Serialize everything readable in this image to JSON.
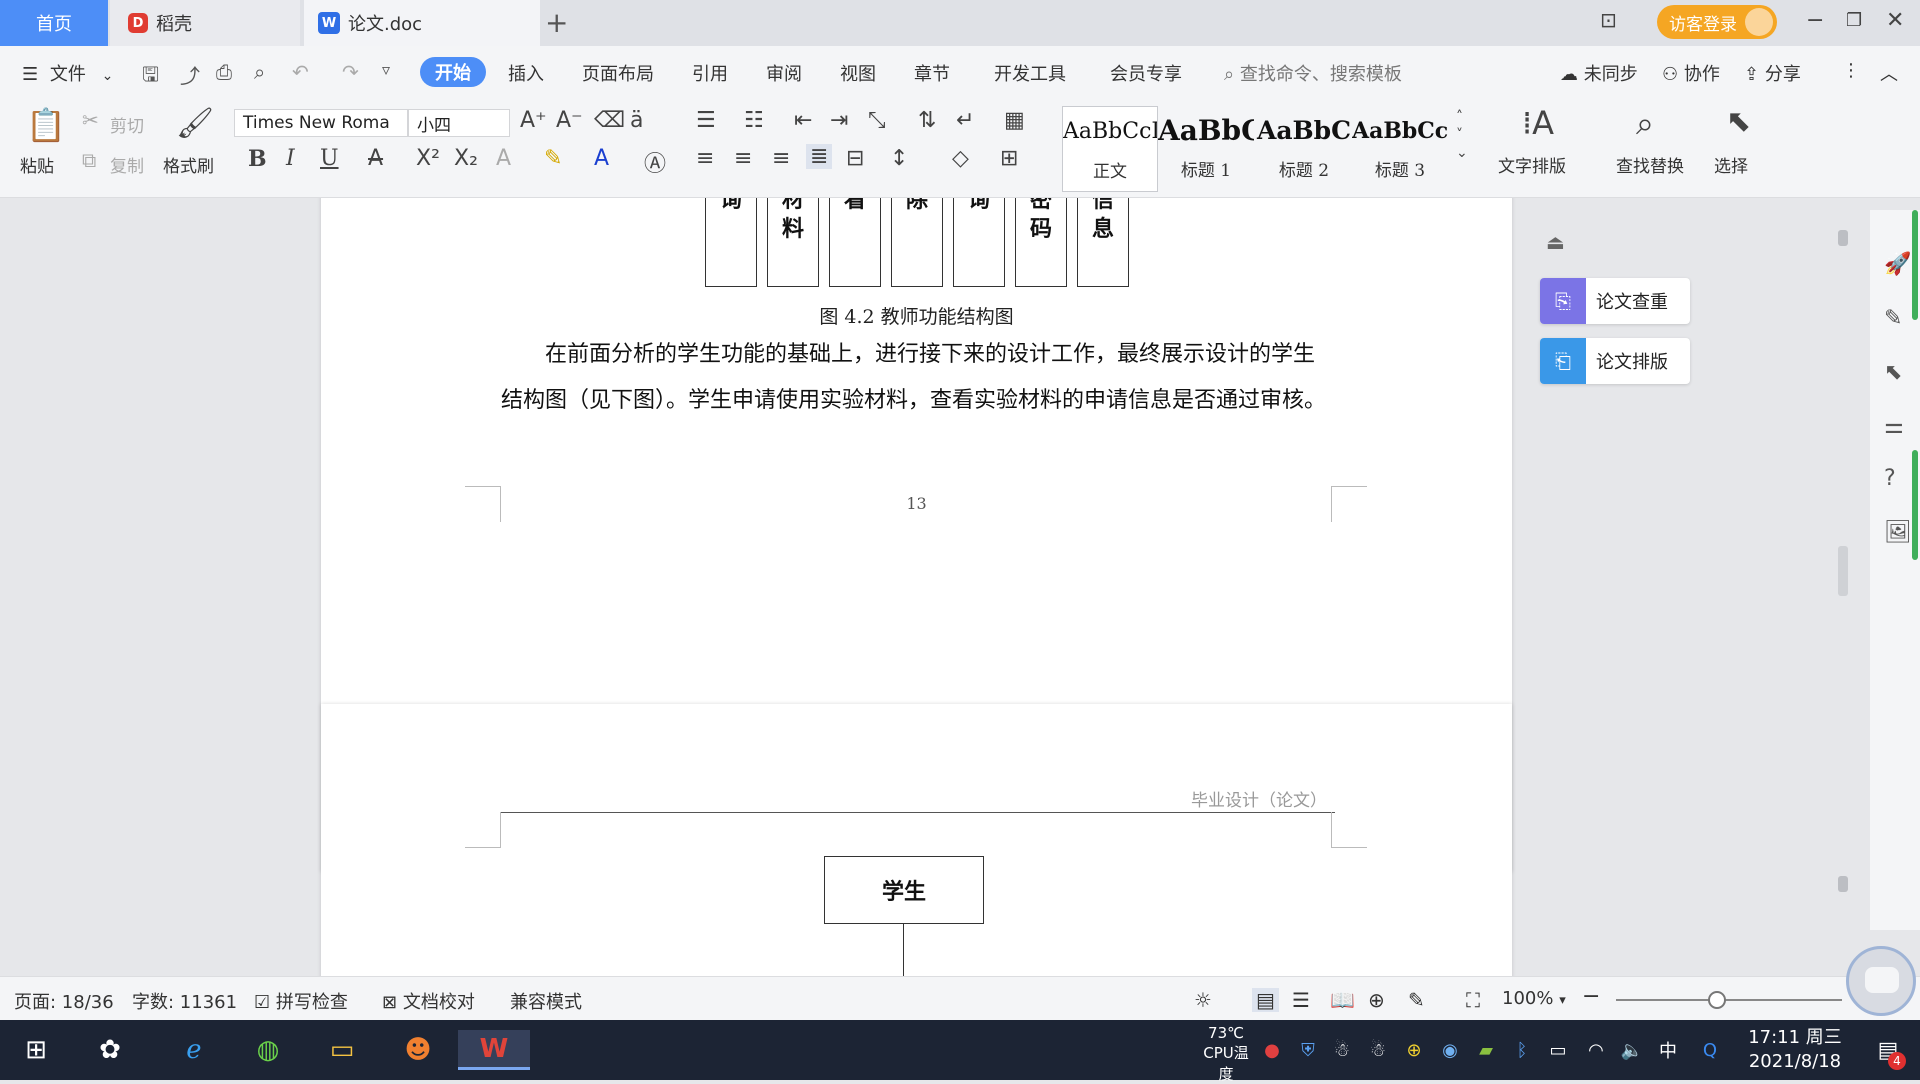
{
  "tabs": {
    "home": "首页",
    "daoke": "稻壳",
    "doc": "论文.doc",
    "plus": "+",
    "login": "访客登录"
  },
  "menu": {
    "file": "文件",
    "items": [
      "开始",
      "插入",
      "页面布局",
      "引用",
      "审阅",
      "视图",
      "章节",
      "开发工具",
      "会员专享"
    ],
    "search_placeholder": "查找命令、搜索模板",
    "unsynced": "未同步",
    "collab": "协作",
    "share": "分享"
  },
  "ribbon": {
    "paste": "粘贴",
    "cut": "剪切",
    "copy": "复制",
    "format_painter": "格式刷",
    "font_name": "Times New Roma",
    "font_size": "小四",
    "styles": [
      {
        "preview": "AaBbCcI",
        "name": "正文"
      },
      {
        "preview": "AaBbC",
        "name": "标题 1"
      },
      {
        "preview": "AaBbC",
        "name": "标题 2"
      },
      {
        "preview": "AaBbCcl",
        "name": "标题 3"
      }
    ],
    "text_layout": "文字排版",
    "find_replace": "查找替换",
    "select": "选择"
  },
  "document": {
    "function_boxes": [
      "询",
      "材料",
      "看",
      "除",
      "询",
      "密码",
      "信息"
    ],
    "figure_caption": "图 4.2  教师功能结构图",
    "paragraph": "在前面分析的学生功能的基础上，进行接下来的设计工作，最终展示设计的学生结构图（见下图）。学生申请使用实验材料，查看实验材料的申请信息是否通过审核。",
    "page_number": "13",
    "header_text": "毕业设计（论文）",
    "student_box": "学生"
  },
  "side_panel": {
    "check": "论文查重",
    "layout": "论文排版"
  },
  "status": {
    "page": "页面: 18/36",
    "words": "字数: 11361",
    "spell": "拼写检查",
    "proof": "文档校对",
    "compat": "兼容模式",
    "zoom": "100%"
  },
  "taskbar": {
    "temp": "73℃",
    "temp_label": "CPU温度",
    "ime": "中",
    "time": "17:11 周三",
    "date": "2021/8/18",
    "badge": "4"
  },
  "colors": {
    "accent": "#4d8ef7",
    "login": "#f5a623",
    "taskbar": "#1c2434"
  }
}
